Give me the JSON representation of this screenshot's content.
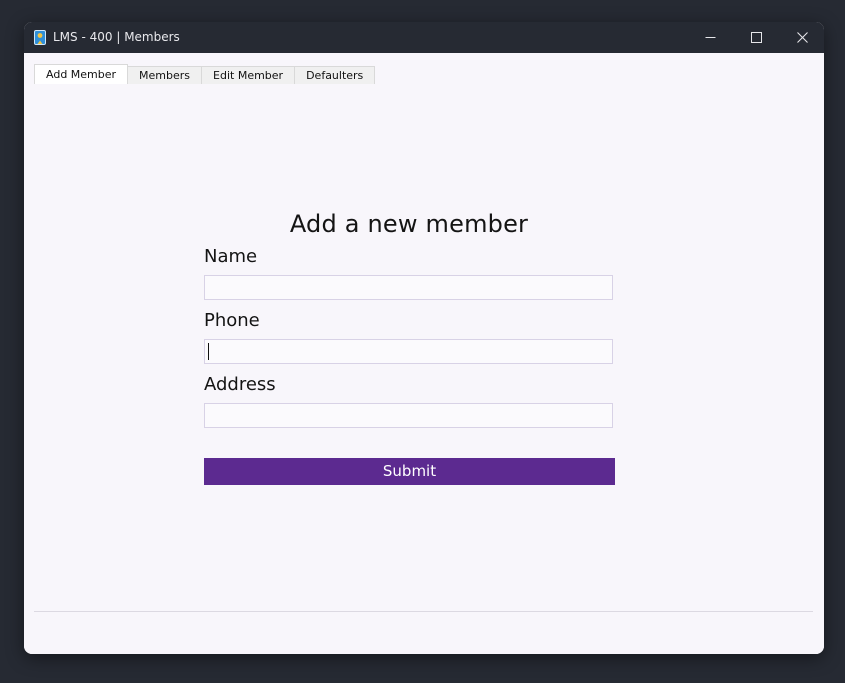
{
  "window": {
    "title": "LMS - 400 | Members",
    "app_icon": "library-book-icon",
    "controls": {
      "minimize_icon": "minimize-icon",
      "maximize_icon": "maximize-icon",
      "close_icon": "close-icon"
    }
  },
  "tabs": [
    {
      "label": "Add Member",
      "active": true
    },
    {
      "label": "Members",
      "active": false
    },
    {
      "label": "Edit Member",
      "active": false
    },
    {
      "label": "Defaulters",
      "active": false
    }
  ],
  "form": {
    "title": "Add a new member",
    "fields": {
      "name": {
        "label": "Name",
        "value": ""
      },
      "phone": {
        "label": "Phone",
        "value": ""
      },
      "address": {
        "label": "Address",
        "value": ""
      }
    },
    "submit_label": "Submit"
  },
  "colors": {
    "accent": "#5c2a90",
    "titlebar": "#262a33",
    "background": "#f8f6fb"
  }
}
